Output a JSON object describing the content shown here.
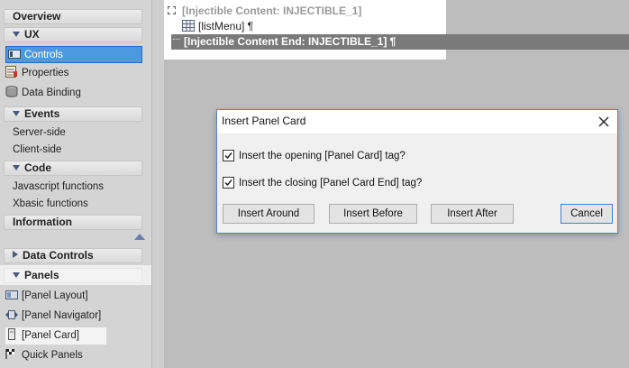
{
  "sidebar": {
    "overview": "Overview",
    "ux": "UX",
    "controls": "Controls",
    "properties": "Properties",
    "data_binding": "Data Binding",
    "events": "Events",
    "server_side": "Server-side",
    "client_side": "Client-side",
    "code": "Code",
    "javascript_functions": "Javascript functions",
    "xbasic_functions": "Xbasic functions",
    "information": "Information",
    "data_controls": "Data Controls",
    "panels": "Panels",
    "panel_layout": "[Panel Layout]",
    "panel_navigator": "[Panel Navigator]",
    "panel_card": "[Panel Card]",
    "quick_panels": "Quick Panels"
  },
  "editor": {
    "injectible_start": "[Injectible Content: INJECTIBLE_1]",
    "list_menu": "[listMenu] ¶",
    "injectible_end": "[Injectible Content End: INJECTIBLE_1] ¶"
  },
  "dialog": {
    "title": "Insert Panel Card",
    "opening_label": "Insert the opening [Panel Card] tag?",
    "opening_checked": true,
    "closing_label": "Insert the closing [Panel Card End] tag?",
    "closing_checked": true,
    "btn_around": "Insert Around",
    "btn_before": "Insert Before",
    "btn_after": "Insert After",
    "btn_cancel": "Cancel"
  },
  "colors": {
    "selection": "#4d99e0",
    "dialog_border": "#5a86c5",
    "header_arrow": "#4a5a78"
  }
}
